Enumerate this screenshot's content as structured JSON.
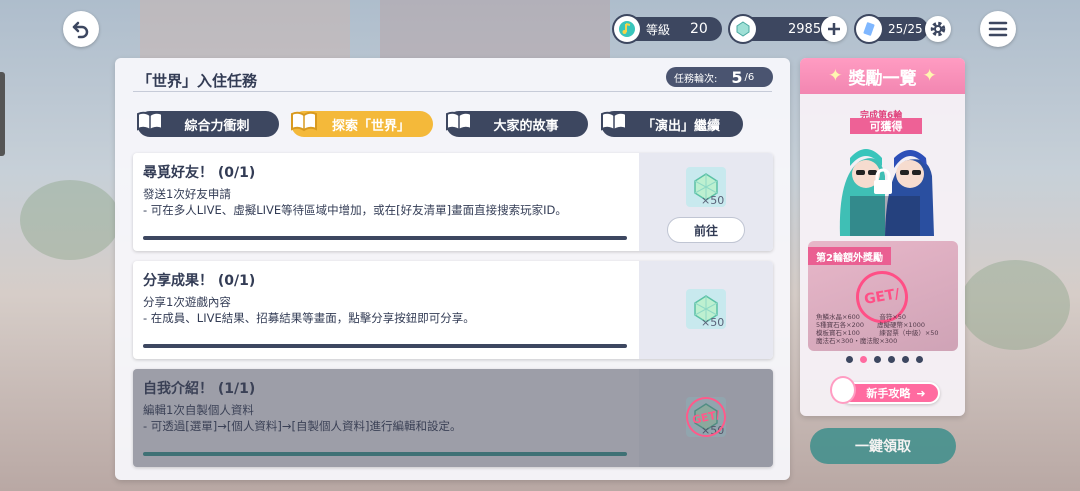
{
  "topbar": {
    "level_label": "等級",
    "level_value": "20",
    "gems": "2985",
    "stamina": "25/25"
  },
  "panel": {
    "title": "「世界」入住任務",
    "round_label": "任務輪次:",
    "round_current": "5",
    "round_total": "/6"
  },
  "tabs": [
    {
      "label": "綜合力衝刺"
    },
    {
      "label": "探索「世界」"
    },
    {
      "label": "大家的故事"
    },
    {
      "label": "「演出」繼續"
    }
  ],
  "tasks": [
    {
      "title": "尋覓好友！ (0/1)",
      "desc1": "發送1次好友申請",
      "desc2": "- 可在多人LIVE、虛擬LIVE等待區域中增加，或在[好友清單]畫面直接搜索玩家ID。",
      "reward_count": "×50",
      "button": "前往"
    },
    {
      "title": "分享成果！ (0/1)",
      "desc1": "分享1次遊戲內容",
      "desc2": "- 在成員、LIVE結果、招募結果等畫面，點擊分享按鈕即可分享。",
      "reward_count": "×50"
    },
    {
      "title": "自我介紹！ (1/1)",
      "desc1": "編輯1次自製個人資料",
      "desc2": "- 可透過[選單]→[個人資料]→[自製個人資料]進行編輯和設定。",
      "reward_count": "×50",
      "stamp": "GET/"
    }
  ],
  "reward_panel": {
    "title": "獎勵一覽",
    "ribbon_small": "完成第6輪",
    "ribbon": "可獲得",
    "bonus_label": "第2輪額外獎勵",
    "bonus_stamp": "GET/",
    "bonus_items": [
      "魚鱗水晶×600　　　音符×50",
      "5種寶石各×200　　虛擬硬幣×1000",
      "模板寶石×100　　　練習票（中級）×50",
      "魔法石×300・魔法骰×300"
    ],
    "guide_button": "新手攻略"
  },
  "claim_all": "一鍵領取",
  "colors": {
    "navy": "#3d4760",
    "tab_active": "#f4b93a",
    "pink": "#ff6ba0",
    "teal": "#3e8f8c"
  }
}
